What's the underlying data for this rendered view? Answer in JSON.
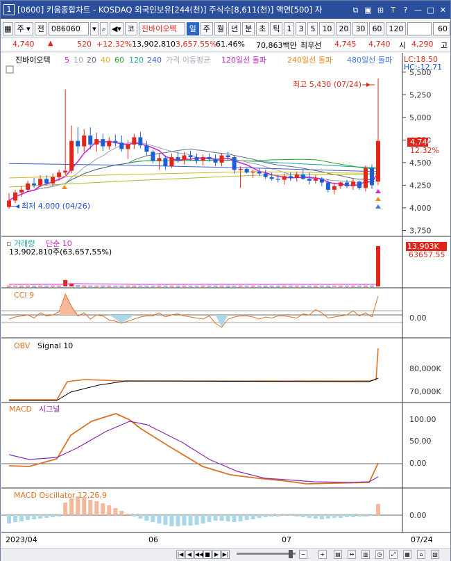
{
  "titlebar": {
    "number": "1",
    "text": "[0600] 키움종합차트 - KOSDAQ 외국인보유[244(천)] 주식수[8,611(천)] 액면[500] 자",
    "icons": [
      "restore-icon",
      "copy-icon",
      "lock-icon",
      "text-icon",
      "help-icon",
      "minimize-icon",
      "maximize-icon",
      "close-icon"
    ]
  },
  "toolbar": {
    "period": "주",
    "prev": "전",
    "code": "086060",
    "stock_name": "진바이오텍",
    "market": "코",
    "periods": [
      "일",
      "주",
      "월",
      "년",
      "분",
      "초",
      "틱"
    ],
    "intervals": [
      "1",
      "3",
      "5",
      "10",
      "20",
      "30",
      "60",
      "120"
    ],
    "count": "60"
  },
  "quote": {
    "price": "4,740",
    "arrow": "▲",
    "change": "520",
    "pct": "+12.32%",
    "volume": "13,902,810",
    "vol_ratio": "3,657.55%",
    "turnover": "61.46%",
    "amount": "70,863백만",
    "best_label": "최우선",
    "best_ask": "4,745",
    "best_bid": "4,740",
    "open_label": "시",
    "open": "4,290",
    "high_label": "고"
  },
  "price_panel": {
    "legend": {
      "name": "진바이오텍",
      "ma": [
        {
          "label": "5",
          "color": "#d920d9"
        },
        {
          "label": "10",
          "color": "#9aa0b5"
        },
        {
          "label": "20",
          "color": "#5f6b8a"
        },
        {
          "label": "40",
          "color": "#d3b520"
        },
        {
          "label": "60",
          "color": "#22aa22"
        },
        {
          "label": "120",
          "color": "#18a7a0"
        },
        {
          "label": "240",
          "color": "#3b5bd6"
        }
      ],
      "ma_label": "가격 이동평균",
      "ma_color": "#aab0c0",
      "lines": [
        {
          "label": "120일선 돌파",
          "color": "#c030c0"
        },
        {
          "label": "240일선 돌파",
          "color": "#f08a20"
        },
        {
          "label": "480일선 돌파",
          "color": "#3b7ad6"
        }
      ]
    },
    "lc": "LC:18.50",
    "hc": "HC:-12.71",
    "high_note": "최고 5,430 (07/24)",
    "low_note": "최저 4,000 (04/26)",
    "current": "4,740",
    "current_pct": "12.32%",
    "axis": [
      "5,500",
      "5,250",
      "5,000",
      "4,750",
      "4,500",
      "4,250",
      "4,000",
      "3,750"
    ]
  },
  "volume_panel": {
    "title": "거래량",
    "ma": "단순 10",
    "info": "13,902,810주(63,657,55%)",
    "current": "13,903K",
    "current2": "63657.55"
  },
  "cci_panel": {
    "title": "CCI 9",
    "axis": "0.00"
  },
  "obv_panel": {
    "title": "OBV",
    "signal": "Signal 10",
    "axis": [
      "80,000K",
      "70,000K"
    ]
  },
  "macd_panel": {
    "title": "MACD",
    "signal": "시그널",
    "axis": [
      "100.00",
      "50.00",
      "0.00"
    ]
  },
  "osc_panel": {
    "title": "MACD Oscillator 12,26,9",
    "axis": "0.00"
  },
  "xaxis": {
    "labels": [
      "2023/04",
      "06",
      "07"
    ],
    "end": "07/24"
  },
  "colors": {
    "up": "#e0251b",
    "down": "#1b5fd6"
  },
  "chart_data": {
    "type": "candlestick",
    "x": [
      "04/26",
      "04/27",
      "04/28",
      "05/02",
      "05/03",
      "05/04",
      "05/08",
      "05/09",
      "05/10",
      "05/11",
      "05/12",
      "05/15",
      "05/16",
      "05/17",
      "05/18",
      "05/19",
      "05/22",
      "05/23",
      "05/24",
      "05/25",
      "05/26",
      "05/30",
      "05/31",
      "06/01",
      "06/02",
      "06/05",
      "06/07",
      "06/08",
      "06/09",
      "06/12",
      "06/13",
      "06/14",
      "06/15",
      "06/16",
      "06/19",
      "06/20",
      "06/21",
      "06/22",
      "06/23",
      "06/26",
      "06/27",
      "06/28",
      "06/29",
      "06/30",
      "07/03",
      "07/04",
      "07/05",
      "07/06",
      "07/07",
      "07/10",
      "07/11",
      "07/12",
      "07/13",
      "07/14",
      "07/17",
      "07/18",
      "07/19",
      "07/20",
      "07/21",
      "07/24"
    ],
    "ohlc": [
      [
        4010,
        4160,
        3990,
        4080
      ],
      [
        4080,
        4200,
        4050,
        4170
      ],
      [
        4170,
        4240,
        4120,
        4200
      ],
      [
        4200,
        4300,
        4180,
        4270
      ],
      [
        4270,
        4330,
        4220,
        4250
      ],
      [
        4250,
        4360,
        4230,
        4320
      ],
      [
        4320,
        4360,
        4250,
        4270
      ],
      [
        4270,
        4380,
        4240,
        4340
      ],
      [
        4340,
        4420,
        4300,
        4390
      ],
      [
        4390,
        5310,
        4360,
        4410
      ],
      [
        4410,
        4910,
        4380,
        4740
      ],
      [
        4740,
        4890,
        4600,
        4680
      ],
      [
        4680,
        4870,
        4620,
        4800
      ],
      [
        4800,
        4890,
        4650,
        4700
      ],
      [
        4700,
        4830,
        4620,
        4760
      ],
      [
        4760,
        4820,
        4630,
        4680
      ],
      [
        4680,
        4780,
        4640,
        4740
      ],
      [
        4740,
        4810,
        4680,
        4720
      ],
      [
        4720,
        4800,
        4620,
        4650
      ],
      [
        4650,
        4750,
        4540,
        4700
      ],
      [
        4700,
        4820,
        4650,
        4780
      ],
      [
        4780,
        4840,
        4660,
        4690
      ],
      [
        4690,
        4740,
        4580,
        4620
      ],
      [
        4620,
        4640,
        4490,
        4520
      ],
      [
        4520,
        4600,
        4420,
        4550
      ],
      [
        4550,
        4580,
        4420,
        4460
      ],
      [
        4460,
        4600,
        4440,
        4560
      ],
      [
        4560,
        4620,
        4500,
        4530
      ],
      [
        4530,
        4620,
        4480,
        4580
      ],
      [
        4580,
        4630,
        4520,
        4560
      ],
      [
        4560,
        4600,
        4490,
        4520
      ],
      [
        4520,
        4590,
        4470,
        4560
      ],
      [
        4560,
        4600,
        4510,
        4540
      ],
      [
        4540,
        4590,
        4460,
        4500
      ],
      [
        4500,
        4600,
        4460,
        4580
      ],
      [
        4580,
        4620,
        4520,
        4560
      ],
      [
        4560,
        4580,
        4380,
        4420
      ],
      [
        4420,
        4460,
        4220,
        4430
      ],
      [
        4430,
        4440,
        4380,
        4390
      ],
      [
        4390,
        4420,
        4330,
        4400
      ],
      [
        4400,
        4440,
        4350,
        4380
      ],
      [
        4380,
        4420,
        4320,
        4340
      ],
      [
        4340,
        4390,
        4300,
        4320
      ],
      [
        4320,
        4360,
        4280,
        4310
      ],
      [
        4310,
        4380,
        4260,
        4350
      ],
      [
        4350,
        4390,
        4300,
        4330
      ],
      [
        4330,
        4400,
        4290,
        4370
      ],
      [
        4370,
        4420,
        4310,
        4320
      ],
      [
        4320,
        4390,
        4260,
        4300
      ],
      [
        4300,
        4360,
        4270,
        4320
      ],
      [
        4320,
        4340,
        4240,
        4280
      ],
      [
        4280,
        4310,
        4170,
        4200
      ],
      [
        4200,
        4280,
        4150,
        4240
      ],
      [
        4240,
        4290,
        4210,
        4280
      ],
      [
        4280,
        4310,
        4220,
        4240
      ],
      [
        4240,
        4330,
        4200,
        4290
      ],
      [
        4290,
        4300,
        4200,
        4220
      ],
      [
        4220,
        4470,
        4180,
        4440
      ],
      [
        4440,
        4480,
        4210,
        4250
      ],
      [
        4290,
        5430,
        4250,
        4740
      ]
    ],
    "volume": [
      80,
      60,
      50,
      40,
      45,
      55,
      35,
      50,
      60,
      2200,
      900,
      320,
      280,
      150,
      240,
      160,
      90,
      110,
      130,
      100,
      80,
      70,
      60,
      50,
      55,
      40,
      45,
      30,
      35,
      40,
      25,
      30,
      30,
      25,
      30,
      35,
      80,
      260,
      50,
      40,
      35,
      30,
      40,
      30,
      30,
      35,
      30,
      25,
      30,
      30,
      40,
      50,
      30,
      30,
      25,
      35,
      30,
      120,
      90,
      13903
    ],
    "ylim": [
      3700,
      5560
    ]
  }
}
